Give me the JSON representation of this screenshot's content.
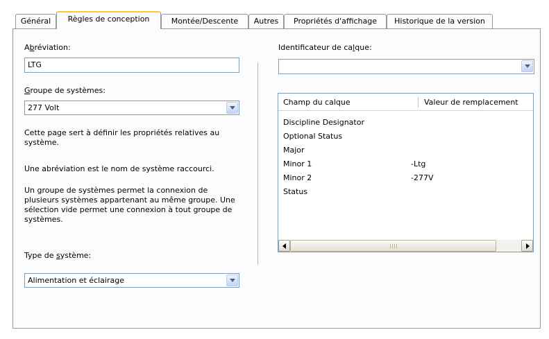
{
  "tabs": [
    {
      "label": "Général",
      "active": false
    },
    {
      "label": "Règles de conception",
      "active": true
    },
    {
      "label": "Montée/Descente",
      "active": false
    },
    {
      "label": "Autres",
      "active": false
    },
    {
      "label": "Propriétés d'affichage",
      "active": false
    },
    {
      "label": "Historique de la version",
      "active": false
    }
  ],
  "left": {
    "abbrev_label_a": "A",
    "abbrev_label_u": "b",
    "abbrev_label_rest": "réviation:",
    "abbrev_value": "LTG",
    "group_label_u": "G",
    "group_label_rest": "roupe de systèmes:",
    "group_value": "277 Volt",
    "desc1": "Cette page sert à définir les propriétés relatives au système.",
    "desc2": "Une abréviation est le nom de système raccourci.",
    "desc3": "Un groupe de systèmes permet la connexion de plusieurs systèmes appartenant au même groupe. Une sélection vide permet une connexion à tout groupe de systèmes.",
    "type_label_pre": "Type de ",
    "type_label_u": "s",
    "type_label_rest": "ystème:",
    "type_value": "Alimentation et éclairage"
  },
  "right": {
    "layer_label_pre": "Identificateur de ca",
    "layer_label_u": "l",
    "layer_label_rest": "que:",
    "layer_value": "",
    "columns": [
      "Champ du calque",
      "Valeur de remplacement"
    ],
    "rows": [
      {
        "field": "Discipline Designator",
        "value": ""
      },
      {
        "field": "Optional Status",
        "value": ""
      },
      {
        "field": "Major",
        "value": ""
      },
      {
        "field": "Minor 1",
        "value": "-Ltg"
      },
      {
        "field": "Minor 2",
        "value": "-277V"
      },
      {
        "field": "Status",
        "value": ""
      }
    ]
  },
  "icons": {
    "dropdown": "chevron-down-icon",
    "scroll_left": "arrow-left-icon",
    "scroll_right": "arrow-right-icon"
  },
  "colors": {
    "active_tab_accent": "#ffc83c",
    "input_border": "#7f9db9"
  }
}
